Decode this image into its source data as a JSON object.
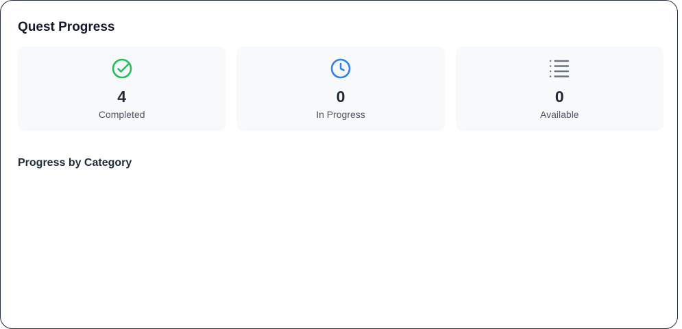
{
  "panel": {
    "title": "Quest Progress",
    "stats": [
      {
        "icon": "check-circle-icon",
        "value": "4",
        "label": "Completed",
        "color": "#1fbf5c"
      },
      {
        "icon": "clock-icon",
        "value": "0",
        "label": "In Progress",
        "color": "#2f80ed"
      },
      {
        "icon": "list-icon",
        "value": "0",
        "label": "Available",
        "color": "#6b7280"
      }
    ],
    "category_section_title": "Progress by Category"
  }
}
